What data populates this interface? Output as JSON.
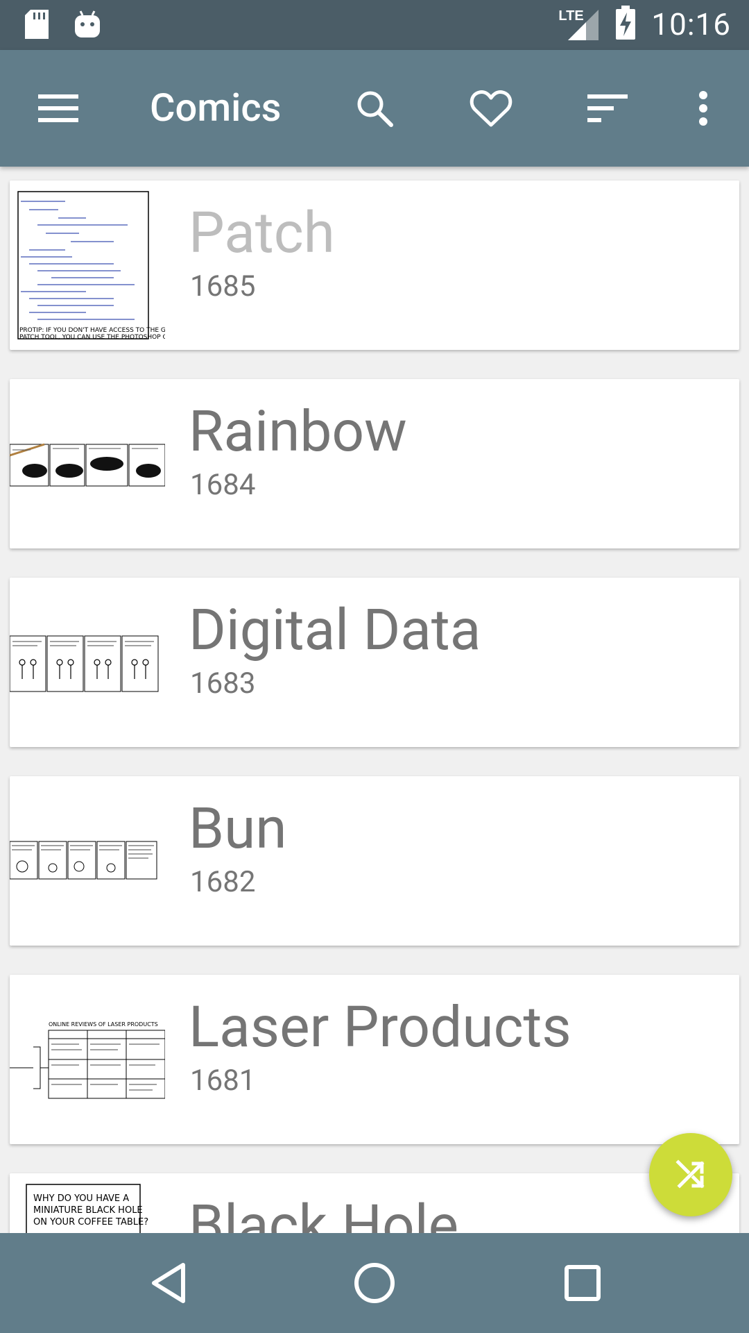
{
  "status_bar": {
    "time": "10:16",
    "network": "LTE",
    "icons": [
      "sd-card-icon",
      "android-icon",
      "lte-signal-icon",
      "battery-charging-icon"
    ]
  },
  "toolbar": {
    "title": "Comics",
    "actions": [
      "menu-icon",
      "search-icon",
      "favorite-icon",
      "sort-icon",
      "more-options-icon"
    ]
  },
  "comics": [
    {
      "title": "Patch",
      "number": "1685",
      "caption_line1": "PROTIP: IF YOU DON'T HAVE ACCESS TO THE GNU",
      "caption_line2": "PATCH TOOL, YOU CAN USE THE PHOTOSHOP ONE."
    },
    {
      "title": "Rainbow",
      "number": "1684"
    },
    {
      "title": "Digital Data",
      "number": "1683"
    },
    {
      "title": "Bun",
      "number": "1682"
    },
    {
      "title": "Laser Products",
      "number": "1681",
      "thumb_heading": "ONLINE REVIEWS OF LASER PRODUCTS"
    },
    {
      "title": "Black Hole",
      "number": "",
      "thumb_line1": "WHY DO YOU HAVE A",
      "thumb_line2": "MINIATURE BLACK HOLE",
      "thumb_line3": "ON YOUR COFFEE TABLE?"
    }
  ],
  "fab": {
    "icon": "shuffle-icon",
    "color": "#cddc39"
  },
  "nav": {
    "buttons": [
      "back-icon",
      "home-icon",
      "recents-icon"
    ]
  },
  "colors": {
    "status_bar": "#4b5d67",
    "toolbar": "#617d8a",
    "navbar": "#617d8a",
    "background": "#f0f0f0"
  }
}
